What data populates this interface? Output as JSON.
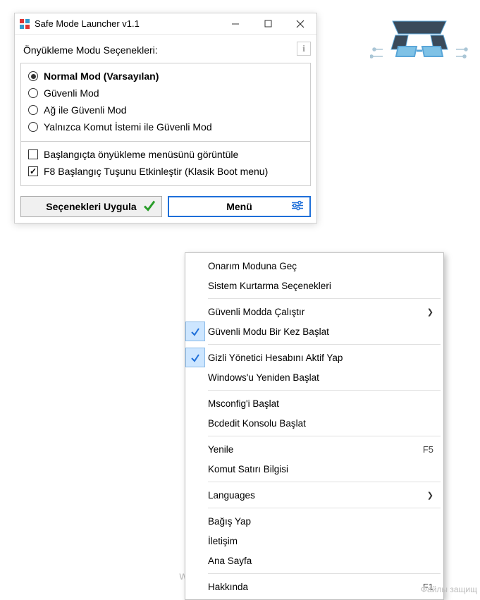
{
  "window": {
    "title": "Safe Mode Launcher v1.1"
  },
  "heading": "Önyükleme Modu Seçenekleri:",
  "boot_options": [
    {
      "label": "Normal Mod (Varsayılan)",
      "selected": true
    },
    {
      "label": "Güvenli Mod",
      "selected": false
    },
    {
      "label": "Ağ ile Güvenli Mod",
      "selected": false
    },
    {
      "label": "Yalnızca Komut İstemi ile Güvenli Mod",
      "selected": false
    }
  ],
  "checkboxes": [
    {
      "label": "Başlangıçta önyükleme menüsünü görüntüle",
      "checked": false
    },
    {
      "label": "F8 Başlangıç Tuşunu Etkinleştir (Klasik Boot menu)",
      "checked": true
    }
  ],
  "buttons": {
    "apply": "Seçenekleri Uygula",
    "menu": "Menü"
  },
  "menu_items": [
    {
      "label": "Onarım Moduna Geç"
    },
    {
      "label": "Sistem Kurtarma Seçenekleri"
    },
    {
      "sep": true
    },
    {
      "label": "Güvenli Modda Çalıştır",
      "submenu": true
    },
    {
      "label": "Güvenli Modu Bir Kez Başlat",
      "checked": true
    },
    {
      "sep": true
    },
    {
      "label": "Gizli Yönetici Hesabını Aktif Yap",
      "checked": true
    },
    {
      "label": "Windows'u Yeniden Başlat"
    },
    {
      "sep": true
    },
    {
      "label": "Msconfig'i Başlat"
    },
    {
      "label": "Bcdedit Konsolu Başlat"
    },
    {
      "sep": true
    },
    {
      "label": "Yenile",
      "shortcut": "F5"
    },
    {
      "label": "Komut Satırı Bilgisi"
    },
    {
      "sep": true
    },
    {
      "label": "Languages",
      "submenu": true
    },
    {
      "sep": true
    },
    {
      "label": "Bağış Yap"
    },
    {
      "label": "İletişim"
    },
    {
      "label": "Ana Sayfa"
    },
    {
      "sep": true
    },
    {
      "label": "Hakkında",
      "shortcut": "F1"
    }
  ],
  "watermark": "www.fullcrackindir.com",
  "corner": "Файлы защищ"
}
